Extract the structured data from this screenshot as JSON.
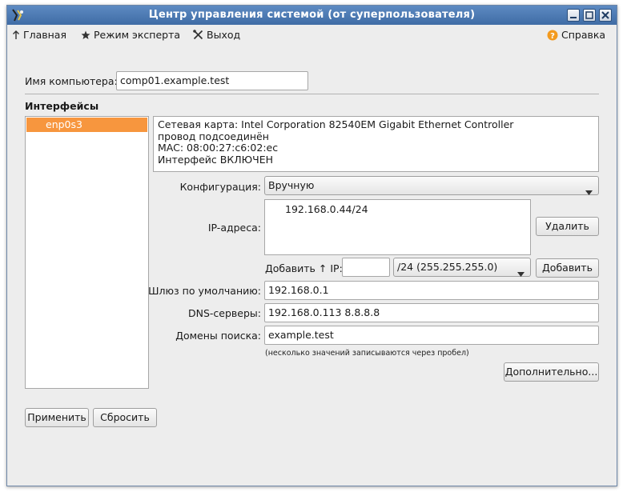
{
  "window": {
    "title": "Центр управления системой (от суперпользователя)"
  },
  "menu": {
    "home": "Главная",
    "expert": "Режим эксперта",
    "exit": "Выход",
    "help": "Справка"
  },
  "form": {
    "hostname_label": "Имя компьютера:",
    "hostname_value": "comp01.example.test",
    "interfaces_heading": "Интерфейсы",
    "interfaces": [
      "enp0s3"
    ],
    "selected_interface": "enp0s3",
    "info_lines": [
      "Сетевая карта: Intel Corporation 82540EM Gigabit Ethernet Controller",
      "провод подсоединён",
      "MAC: 08:00:27:c6:02:ec",
      "Интерфейс ВКЛЮЧЕН"
    ],
    "config_label": "Конфигурация:",
    "config_value": "Вручную",
    "ip_label": "IP-адреса:",
    "ip_addresses": [
      "192.168.0.44/24"
    ],
    "delete_button": "Удалить",
    "add_ip_label": "Добавить ↑ IP:",
    "add_ip_value": "",
    "mask_value": "/24 (255.255.255.0)",
    "add_button": "Добавить",
    "gateway_label": "Шлюз по умолчанию:",
    "gateway_value": "192.168.0.1",
    "dns_label": "DNS-серверы:",
    "dns_value": "192.168.0.113 8.8.8.8",
    "search_label": "Домены поиска:",
    "search_value": "example.test",
    "hint": "(несколько значений записываются через пробел)",
    "advanced_button": "Дополнительно...",
    "apply_button": "Применить",
    "reset_button": "Сбросить"
  },
  "colors": {
    "titlebar": "#4a79b4",
    "selection": "#f7963e",
    "help_icon": "#f39a1e"
  }
}
